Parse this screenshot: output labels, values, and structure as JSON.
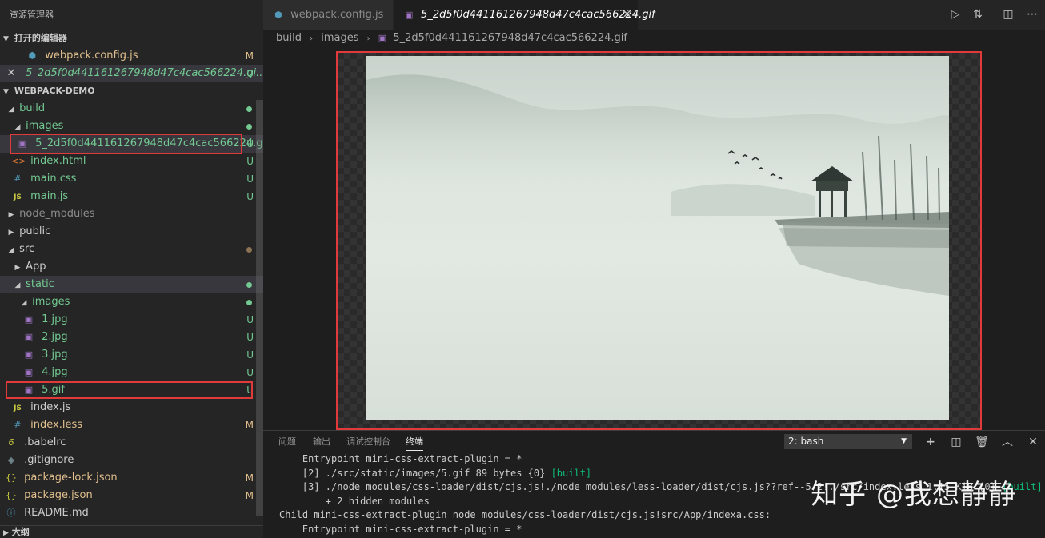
{
  "sidebar": {
    "title": "资源管理器",
    "open_editors_header": "打开的编辑器",
    "open_editors": [
      {
        "name": "webpack.config.js",
        "badge": "M"
      },
      {
        "name": "5_2d5f0d441161267948d47c4cac566224.gi...",
        "badge": "U"
      }
    ],
    "project_header": "WEBPACK-DEMO",
    "tree": [
      {
        "name": "build"
      },
      {
        "name": "images"
      },
      {
        "name": "5_2d5f0d441161267948d47c4cac566224.gif",
        "badge": "U"
      },
      {
        "name": "index.html",
        "badge": "U"
      },
      {
        "name": "main.css",
        "badge": "U"
      },
      {
        "name": "main.js",
        "badge": "U"
      },
      {
        "name": "node_modules"
      },
      {
        "name": "public"
      },
      {
        "name": "src"
      },
      {
        "name": "App"
      },
      {
        "name": "static"
      },
      {
        "name": "images"
      },
      {
        "name": "1.jpg",
        "badge": "U"
      },
      {
        "name": "2.jpg",
        "badge": "U"
      },
      {
        "name": "3.jpg",
        "badge": "U"
      },
      {
        "name": "4.jpg",
        "badge": "U"
      },
      {
        "name": "5.gif",
        "badge": "U"
      },
      {
        "name": "index.js"
      },
      {
        "name": "index.less",
        "badge": "M"
      },
      {
        "name": ".babelrc"
      },
      {
        "name": ".gitignore"
      },
      {
        "name": "package-lock.json",
        "badge": "M"
      },
      {
        "name": "package.json",
        "badge": "M"
      },
      {
        "name": "README.md"
      }
    ],
    "outline_header": "大纲"
  },
  "icons": {
    "js": "JS",
    "css": "#",
    "html": "<>",
    "json": "{}",
    "babel": "6"
  },
  "tabs": [
    {
      "label": "webpack.config.js"
    },
    {
      "label": "5_2d5f0d441161267948d47c4cac566224.gif"
    }
  ],
  "breadcrumb": [
    "build",
    "images",
    "5_2d5f0d441161267948d47c4cac566224.gif"
  ],
  "panel": {
    "tabs": [
      "问题",
      "输出",
      "调试控制台",
      "终端"
    ],
    "terminal_select": "2: bash",
    "lines": [
      {
        "indent": "    ",
        "text": "Entrypoint mini-css-extract-plugin = *"
      },
      {
        "indent": "    ",
        "text": "[2] ./src/static/images/5.gif 89 bytes {0} ",
        "built": "[built]"
      },
      {
        "indent": "    ",
        "text": "[3] ./node_modules/css-loader/dist/cjs.js!./node_modules/less-loader/dist/cjs.js??ref--5-2!./src/index.less 1.15 KiB {0} ",
        "built": "[built]"
      },
      {
        "indent": "        ",
        "text": "+ 2 hidden modules"
      },
      {
        "indent": "",
        "text": "Child mini-css-extract-plugin node_modules/css-loader/dist/cjs.js!src/App/indexa.css:"
      },
      {
        "indent": "    ",
        "text": "Entrypoint mini-css-extract-plugin = *"
      }
    ]
  },
  "watermark": "知乎 @我想静静",
  "colors": {
    "untracked": "#73c991",
    "modified": "#e2c08d",
    "highlight": "#e03a3a"
  }
}
